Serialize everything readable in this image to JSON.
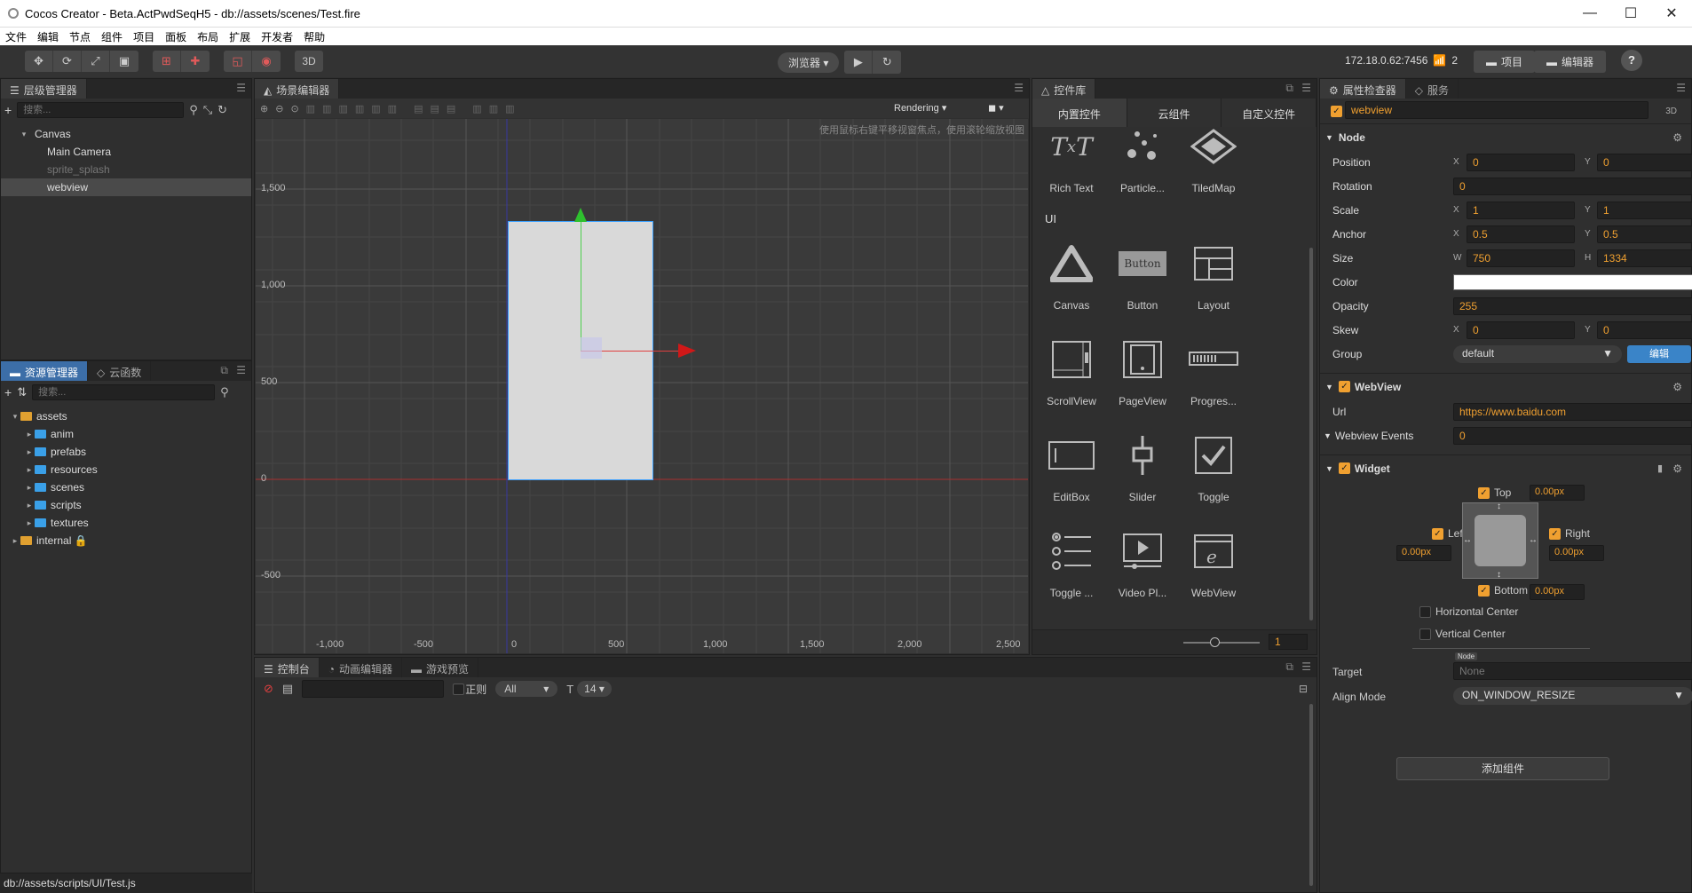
{
  "window": {
    "title": "Cocos Creator - Beta.ActPwdSeqH5 - db://assets/scenes/Test.fire",
    "minimize": "—",
    "maximize": "☐",
    "close": "✕"
  },
  "menu": [
    "文件",
    "编辑",
    "节点",
    "组件",
    "项目",
    "面板",
    "布局",
    "扩展",
    "开发者",
    "帮助"
  ],
  "toolbar": {
    "mode_3d": "3D",
    "preview_select": "浏览器 ▾",
    "ip": "172.18.0.62:7456",
    "devices": "2",
    "project_btn": "项目",
    "editor_btn": "编辑器",
    "help": "?"
  },
  "hierarchy": {
    "tab": "层级管理器",
    "search_placeholder": "搜索...",
    "items": [
      {
        "label": "Canvas",
        "level": 0,
        "expand": "▾"
      },
      {
        "label": "Main Camera",
        "level": 1
      },
      {
        "label": "sprite_splash",
        "level": 1,
        "dim": true
      },
      {
        "label": "webview",
        "level": 1,
        "selected": true
      }
    ]
  },
  "assets": {
    "tab": "资源管理器",
    "tab2": "云函数",
    "search_placeholder": "搜索...",
    "items": [
      {
        "label": "assets",
        "level": 0,
        "expand": "▾",
        "gold": true
      },
      {
        "label": "anim",
        "level": 1,
        "expand": "▸"
      },
      {
        "label": "prefabs",
        "level": 1,
        "expand": "▸"
      },
      {
        "label": "resources",
        "level": 1,
        "expand": "▸"
      },
      {
        "label": "scenes",
        "level": 1,
        "expand": "▸"
      },
      {
        "label": "scripts",
        "level": 1,
        "expand": "▸"
      },
      {
        "label": "textures",
        "level": 1,
        "expand": "▸"
      },
      {
        "label": "internal 🔒",
        "level": 0,
        "expand": "▸",
        "gold": true
      }
    ],
    "status": "db://assets/scripts/UI/Test.js"
  },
  "scene": {
    "tab": "场景编辑器",
    "rendering": "Rendering",
    "hint": "使用鼠标右键平移视窗焦点，使用滚轮缩放视图",
    "y_labels": [
      "1,500",
      "1,000",
      "500",
      "0",
      "-500"
    ],
    "x_labels": [
      "-1,000",
      "-500",
      "0",
      "500",
      "1,000",
      "1,500",
      "2,000",
      "2,500"
    ]
  },
  "library": {
    "tab": "控件库",
    "subtabs": [
      "内置控件",
      "云组件",
      "自定义控件"
    ],
    "row0": [
      {
        "label": "Rich Text",
        "icon": "richtext-icon"
      },
      {
        "label": "Particle...",
        "icon": "particle-icon"
      },
      {
        "label": "TiledMap",
        "icon": "tiledmap-icon"
      }
    ],
    "section_ui": "UI",
    "ui": [
      {
        "label": "Canvas",
        "icon": "canvas-icon"
      },
      {
        "label": "Button",
        "icon": "button-icon"
      },
      {
        "label": "Layout",
        "icon": "layout-icon"
      },
      {
        "label": "ScrollView",
        "icon": "scrollview-icon"
      },
      {
        "label": "PageView",
        "icon": "pageview-icon"
      },
      {
        "label": "Progres...",
        "icon": "progress-icon"
      },
      {
        "label": "EditBox",
        "icon": "editbox-icon"
      },
      {
        "label": "Slider",
        "icon": "slider-icon"
      },
      {
        "label": "Toggle",
        "icon": "toggle-icon"
      },
      {
        "label": "Toggle ...",
        "icon": "togglegroup-icon"
      },
      {
        "label": "Video Pl...",
        "icon": "videoplayer-icon"
      },
      {
        "label": "WebView",
        "icon": "webview-icon"
      }
    ],
    "button_text": "Button",
    "zoom_value": "1"
  },
  "console": {
    "tabs": [
      "控制台",
      "动画编辑器",
      "游戏预览"
    ],
    "regex_label": "正则",
    "filter": "All",
    "font_size": "14"
  },
  "inspector": {
    "tab": "属性检查器",
    "tab2": "服务",
    "node_name": "webview",
    "mode_3d": "3D",
    "node_section": "Node",
    "position": {
      "label": "Position",
      "x": "0",
      "y": "0"
    },
    "rotation": {
      "label": "Rotation",
      "value": "0"
    },
    "scale": {
      "label": "Scale",
      "x": "1",
      "y": "1"
    },
    "anchor": {
      "label": "Anchor",
      "x": "0.5",
      "y": "0.5"
    },
    "size": {
      "label": "Size",
      "w": "750",
      "h": "1334"
    },
    "color": {
      "label": "Color",
      "value": "#ffffff"
    },
    "opacity": {
      "label": "Opacity",
      "value": "255"
    },
    "skew": {
      "label": "Skew",
      "x": "0",
      "y": "0"
    },
    "group": {
      "label": "Group",
      "value": "default",
      "edit": "编辑"
    },
    "webview_section": "WebView",
    "url": {
      "label": "Url",
      "value": "https://www.baidu.com"
    },
    "events": {
      "label": "Webview Events",
      "value": "0"
    },
    "widget_section": "Widget",
    "widget": {
      "top": "Top",
      "top_val": "0.00px",
      "left": "Left",
      "left_val": "0.00px",
      "right": "Right",
      "right_val": "0.00px",
      "bottom": "Bottom",
      "bottom_val": "0.00px",
      "hcenter": "Horizontal Center",
      "vcenter": "Vertical Center",
      "target_label": "Target",
      "target_tag": "Node",
      "target_placeholder": "None",
      "align_label": "Align Mode",
      "align_value": "ON_WINDOW_RESIZE"
    },
    "add_component": "添加组件"
  }
}
